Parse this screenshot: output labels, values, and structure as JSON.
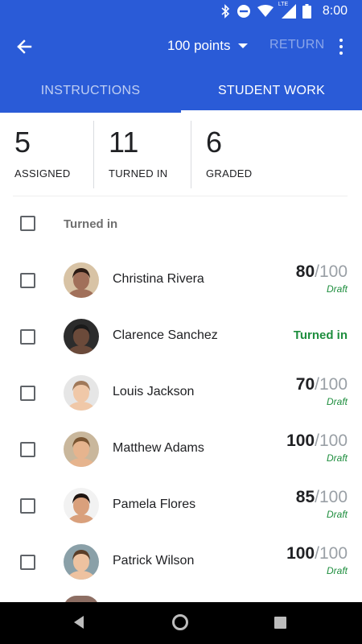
{
  "status_bar": {
    "time": "8:00",
    "network": "LTE"
  },
  "app_bar": {
    "points_label": "100 points",
    "return_label": "RETURN"
  },
  "tabs": [
    {
      "label": "INSTRUCTIONS",
      "active": false
    },
    {
      "label": "STUDENT WORK",
      "active": true
    }
  ],
  "stats": [
    {
      "value": "5",
      "label": "ASSIGNED"
    },
    {
      "value": "11",
      "label": "TURNED IN"
    },
    {
      "value": "6",
      "label": "GRADED"
    }
  ],
  "list_header": {
    "label": "Turned in"
  },
  "students": [
    {
      "name": "Christina Rivera",
      "score": "80",
      "out_of": "/100",
      "status": "Draft",
      "avatar_skin": "#a1705a",
      "avatar_hair": "#2b1b14",
      "avatar_bg": "#d8c3a5"
    },
    {
      "name": "Clarence Sanchez",
      "turned_in": "Turned in",
      "avatar_skin": "#6b4a3a",
      "avatar_hair": "#1a1a1a",
      "avatar_bg": "#2c2c2c"
    },
    {
      "name": "Louis Jackson",
      "score": "70",
      "out_of": "/100",
      "status": "Draft",
      "avatar_skin": "#f0c8a8",
      "avatar_hair": "#a0795a",
      "avatar_bg": "#e6e6e6"
    },
    {
      "name": "Matthew Adams",
      "score": "100",
      "out_of": "/100",
      "status": "Draft",
      "avatar_skin": "#e6b48e",
      "avatar_hair": "#7a5532",
      "avatar_bg": "#c9b79c"
    },
    {
      "name": "Pamela Flores",
      "score": "85",
      "out_of": "/100",
      "status": "Draft",
      "avatar_skin": "#d9a07c",
      "avatar_hair": "#1e1410",
      "avatar_bg": "#f2f2f2"
    },
    {
      "name": "Patrick Wilson",
      "score": "100",
      "out_of": "/100",
      "status": "Draft",
      "avatar_skin": "#eec2a0",
      "avatar_hair": "#5a3d28",
      "avatar_bg": "#8aa0a8"
    }
  ],
  "colors": {
    "primary": "#2a5bd7",
    "success_green": "#1e8e3e",
    "muted_text": "#9aa0a6"
  }
}
